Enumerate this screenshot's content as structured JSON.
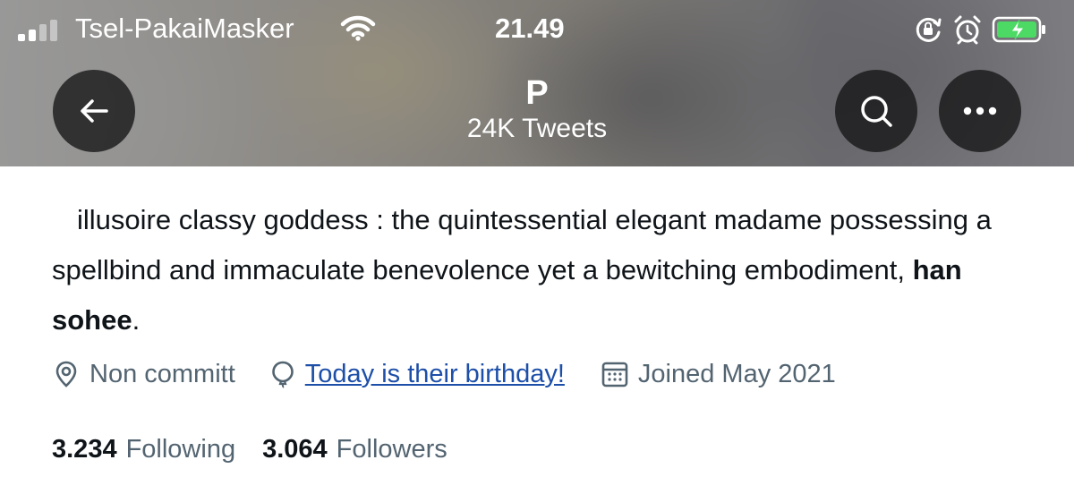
{
  "status_bar": {
    "carrier": "Tsel-PakaiMasker",
    "time": "21.49",
    "icons": [
      "signal-icon",
      "wifi-icon",
      "rotation-lock-icon",
      "alarm-icon",
      "battery-charging-icon"
    ],
    "battery_color": "#4cd964"
  },
  "header": {
    "profile_name": "P",
    "tweet_count": "24K Tweets",
    "back_icon": "arrow-left-icon",
    "search_icon": "search-icon",
    "more_icon": "more-icon"
  },
  "bio": {
    "text_before": "illusoire classy goddess : the quintessential elegant madame possessing a spellbind and immaculate benevolence yet a bewitching embodiment, ",
    "bold": "han sohee",
    "text_after": "."
  },
  "meta": {
    "location": "Non committ",
    "birthday": "Today is their birthday!",
    "joined": "Joined May 2021",
    "link_color": "#1d4fa8",
    "muted_color": "#536471"
  },
  "stats": {
    "following_count": "3.234",
    "following_label": "Following",
    "followers_count": "3.064",
    "followers_label": "Followers"
  }
}
